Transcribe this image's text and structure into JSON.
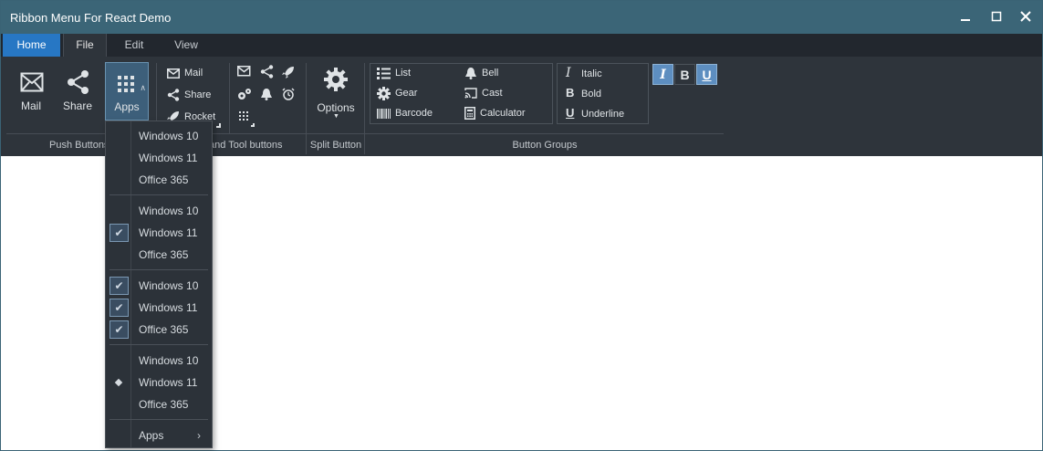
{
  "window": {
    "title": "Ribbon Menu For React Demo",
    "minimize": "—",
    "maximize": "☐",
    "close": "✕"
  },
  "tabs": [
    "Home",
    "File",
    "Edit",
    "View"
  ],
  "push_buttons": {
    "mail": "Mail",
    "share": "Share",
    "apps": "Apps"
  },
  "small_buttons": {
    "mail": "Mail",
    "share": "Share",
    "rocket": "Rocket"
  },
  "split_button": {
    "options": "Options"
  },
  "group_list": {
    "list": "List",
    "gear": "Gear",
    "barcode": "Barcode",
    "bell": "Bell",
    "cast": "Cast",
    "calculator": "Calculator"
  },
  "group_format": {
    "italic": "Italic",
    "bold": "Bold",
    "underline": "Underline"
  },
  "toggles": {
    "italic": "I",
    "bold": "B",
    "underline": "U"
  },
  "group_labels": {
    "push": "Push Buttons",
    "tool": "Small and Tool buttons",
    "split": "Split Button",
    "groups": "Button Groups"
  },
  "menu": {
    "g1": [
      "Windows 10",
      "Windows 11",
      "Office 365"
    ],
    "g2": [
      "Windows 10",
      "Windows 11",
      "Office 365"
    ],
    "g3": [
      "Windows 10",
      "Windows 11",
      "Office 365"
    ],
    "g4": [
      "Windows 10",
      "Windows 11",
      "Office 365"
    ],
    "submenu": "Apps",
    "submenu_arrow": "›",
    "check": "✔"
  },
  "colors": {
    "titlebar": "#3b6577",
    "home_tab": "#2777c4",
    "ribbon": "#2e343b",
    "toggle_on": "#5d8ec0"
  }
}
